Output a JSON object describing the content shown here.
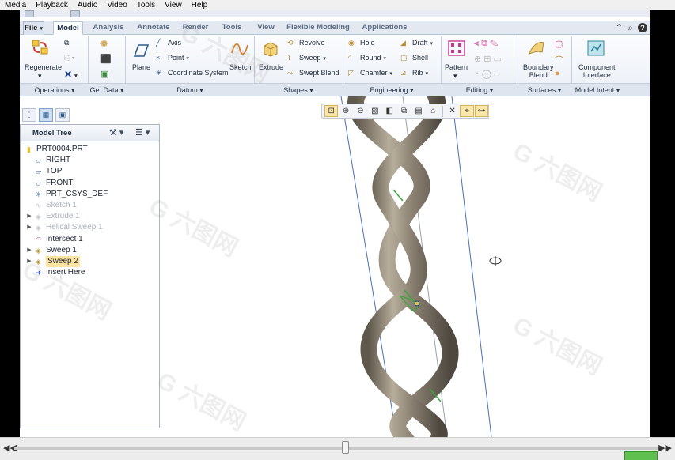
{
  "player": {
    "menu": [
      "Media",
      "Playback",
      "Audio",
      "Video",
      "Tools",
      "View",
      "Help"
    ]
  },
  "ribbon": {
    "tabs": [
      "File",
      "Model",
      "Analysis",
      "Annotate",
      "Render",
      "Tools",
      "View",
      "Flexible Modeling",
      "Applications"
    ],
    "active_tab": "Model",
    "operations": {
      "regenerate": "Regenerate"
    },
    "datum": {
      "plane": "Plane",
      "axis": "Axis",
      "point": "Point",
      "coordinate_system": "Coordinate System",
      "sketch": "Sketch"
    },
    "shapes": {
      "extrude": "Extrude",
      "revolve": "Revolve",
      "sweep": "Sweep",
      "swept_blend": "Swept Blend"
    },
    "engineering": {
      "hole": "Hole",
      "round": "Round",
      "chamfer": "Chamfer",
      "draft": "Draft",
      "shell": "Shell",
      "rib": "Rib"
    },
    "editing": {
      "pattern": "Pattern"
    },
    "surfaces": {
      "boundary_blend_line1": "Boundary",
      "boundary_blend_line2": "Blend"
    },
    "model_intent": {
      "component_interface_line1": "Component",
      "component_interface_line2": "Interface"
    },
    "group_labels": [
      "Operations",
      "Get Data",
      "Datum",
      "Shapes",
      "Engineering",
      "Editing",
      "Surfaces",
      "Model Intent"
    ]
  },
  "model_tree": {
    "title": "Model Tree",
    "items": [
      {
        "label": "PRT0004.PRT",
        "state": "normal",
        "expand": ""
      },
      {
        "label": "RIGHT",
        "state": "normal",
        "expand": ""
      },
      {
        "label": "TOP",
        "state": "normal",
        "expand": ""
      },
      {
        "label": "FRONT",
        "state": "normal",
        "expand": ""
      },
      {
        "label": "PRT_CSYS_DEF",
        "state": "normal",
        "expand": ""
      },
      {
        "label": "Sketch 1",
        "state": "dim",
        "expand": ""
      },
      {
        "label": "Extrude 1",
        "state": "dim",
        "expand": "▶"
      },
      {
        "label": "Helical Sweep 1",
        "state": "dim",
        "expand": "▶"
      },
      {
        "label": "Intersect 1",
        "state": "normal",
        "expand": ""
      },
      {
        "label": "Sweep 1",
        "state": "normal",
        "expand": "▶"
      },
      {
        "label": "Sweep 2",
        "state": "highlight",
        "expand": "▶"
      },
      {
        "label": "Insert Here",
        "state": "normal",
        "expand": ""
      }
    ]
  },
  "watermark_text": "G 六图网",
  "colors": {
    "accent": "#2c5a8c",
    "highlight": "#fbe3a1",
    "model": "#8c8273",
    "edge_green": "#36a836"
  }
}
